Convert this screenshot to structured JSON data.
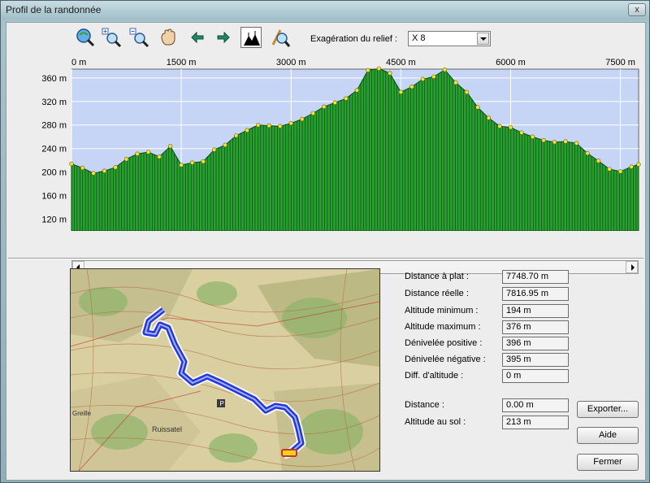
{
  "window": {
    "title": "Profil de la randonnée",
    "close_label": "x"
  },
  "toolbar": {
    "tools": [
      {
        "name": "zoom-fit-icon"
      },
      {
        "name": "zoom-in-icon"
      },
      {
        "name": "zoom-out-icon"
      },
      {
        "name": "pan-hand-icon"
      },
      {
        "name": "arrow-left-icon"
      },
      {
        "name": "arrow-right-icon"
      },
      {
        "name": "relief-profile-icon",
        "active": true
      },
      {
        "name": "zoom-tool-icon"
      }
    ],
    "relief_label": "Exagération du relief :",
    "relief_value": "X 8"
  },
  "chart_data": {
    "type": "area",
    "x_ticks": [
      "0 m",
      "1500 m",
      "3000 m",
      "4500 m",
      "6000 m",
      "7500 m"
    ],
    "y_ticks": [
      "360 m",
      "320 m",
      "280 m",
      "240 m",
      "200 m",
      "160 m",
      "120 m"
    ],
    "xlim": [
      0,
      7748.7
    ],
    "ylim": [
      100,
      375
    ],
    "grid": true,
    "x": [
      0,
      150,
      300,
      450,
      600,
      750,
      900,
      1050,
      1200,
      1350,
      1500,
      1650,
      1800,
      1950,
      2100,
      2250,
      2400,
      2550,
      2700,
      2850,
      3000,
      3150,
      3300,
      3450,
      3600,
      3750,
      3900,
      4050,
      4200,
      4350,
      4500,
      4650,
      4800,
      4950,
      5100,
      5250,
      5400,
      5550,
      5700,
      5850,
      6000,
      6150,
      6300,
      6450,
      6600,
      6750,
      6900,
      7050,
      7200,
      7350,
      7500,
      7650,
      7748
    ],
    "y": [
      214,
      207,
      198,
      202,
      208,
      222,
      231,
      234,
      226,
      244,
      212,
      216,
      218,
      238,
      246,
      262,
      271,
      280,
      279,
      278,
      283,
      290,
      300,
      311,
      318,
      325,
      339,
      373,
      376,
      368,
      336,
      345,
      358,
      362,
      374,
      352,
      336,
      310,
      292,
      278,
      276,
      267,
      260,
      254,
      251,
      252,
      249,
      232,
      219,
      205,
      201,
      209,
      213
    ],
    "area_color": "#27a030",
    "background_color": "#c6d5f5"
  },
  "map": {
    "place_labels": [
      "Ruissatel",
      "Greille"
    ],
    "route_color": "#2936d8"
  },
  "stats": [
    {
      "label": "Distance à plat :",
      "value": "7748.70 m"
    },
    {
      "label": "Distance réelle :",
      "value": "7816.95 m"
    },
    {
      "label": "Altitude minimum :",
      "value": "194 m"
    },
    {
      "label": "Altitude maximum :",
      "value": "376 m"
    },
    {
      "label": "Dénivelée positive :",
      "value": "396 m"
    },
    {
      "label": "Dénivelée négative :",
      "value": "395 m"
    },
    {
      "label": "Diff. d'altitude :",
      "value": "0 m"
    },
    {
      "label": "Distance :",
      "value": "0.00 m"
    },
    {
      "label": "Altitude au sol :",
      "value": "213 m"
    }
  ],
  "buttons": {
    "export": "Exporter...",
    "help": "Aide",
    "close": "Fermer"
  }
}
